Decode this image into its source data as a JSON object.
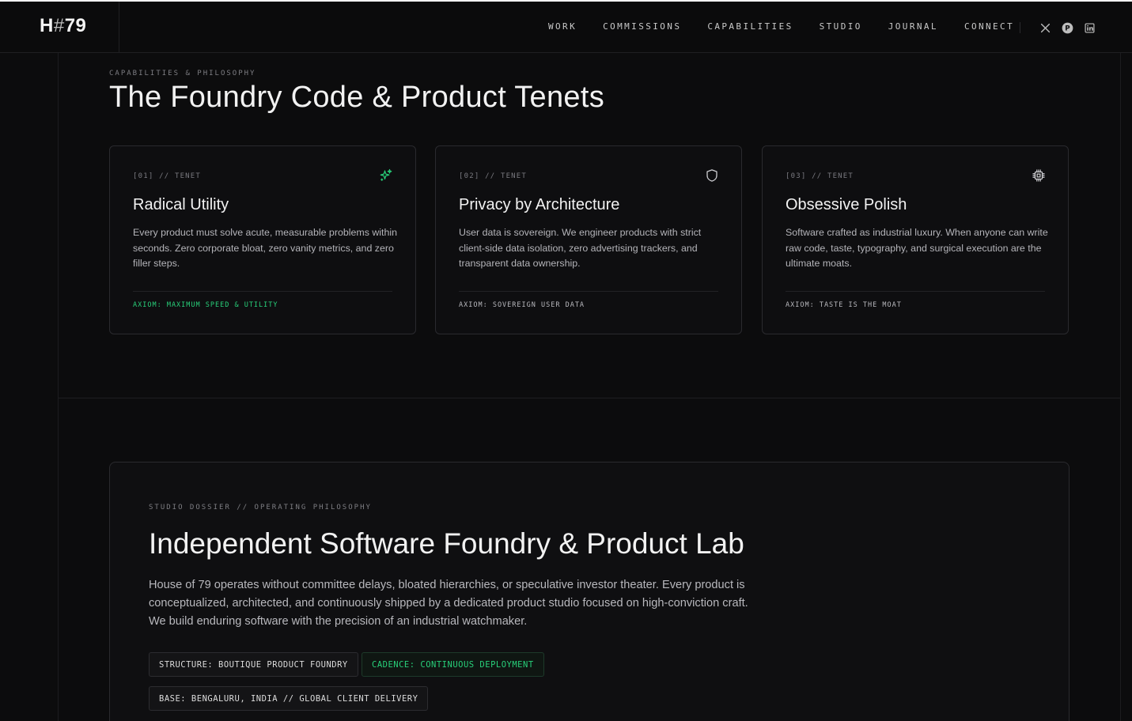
{
  "header": {
    "logo": {
      "prefix": "H",
      "hash": "#",
      "suffix": "79"
    },
    "nav": [
      "WORK",
      "COMMISSIONS",
      "CAPABILITIES",
      "STUDIO",
      "JOURNAL",
      "CONNECT"
    ],
    "socials": [
      "x-icon",
      "pinterest-icon",
      "linkedin-icon"
    ]
  },
  "tenets": {
    "eyebrow": "CAPABILITIES & PHILOSOPHY",
    "title": "The Foundry Code & Product Tenets",
    "cards": [
      {
        "tag": "[01] // TENET",
        "icon": "sparkles-icon",
        "title": "Radical Utility",
        "desc": "Every product must solve acute, measurable problems within seconds. Zero corporate bloat, zero vanity metrics, and zero filler steps.",
        "axiom": "AXIOM: MAXIMUM SPEED & UTILITY",
        "accent": "#28d07a"
      },
      {
        "tag": "[02] // TENET",
        "icon": "shield-icon",
        "title": "Privacy by Architecture",
        "desc": "User data is sovereign. We engineer products with strict client-side data isolation, zero advertising trackers, and transparent data ownership.",
        "axiom": "AXIOM: SOVEREIGN USER DATA"
      },
      {
        "tag": "[03] // TENET",
        "icon": "chip-icon",
        "title": "Obsessive Polish",
        "desc": "Software crafted as industrial luxury. When anyone can write raw code, taste, typography, and surgical execution are the ultimate moats.",
        "axiom": "AXIOM: TASTE IS THE MOAT"
      }
    ]
  },
  "dossier": {
    "eyebrow": "STUDIO DOSSIER // OPERATING PHILOSOPHY",
    "title": "Independent Software Foundry & Product Lab",
    "body": "House of 79 operates without committee delays, bloated hierarchies, or speculative investor theater. Every product is conceptualized, architected, and continuously shipped by a dedicated product studio focused on high-conviction craft. We build enduring software with the precision of an industrial watchmaker.",
    "chips": [
      "STRUCTURE: BOUTIQUE PRODUCT FOUNDRY",
      "CADENCE: CONTINUOUS DEPLOYMENT",
      "BASE: BENGALURU, INDIA // GLOBAL CLIENT DELIVERY"
    ]
  },
  "colors": {
    "accent_green": "#28d07a",
    "background": "#0c0c0d"
  }
}
